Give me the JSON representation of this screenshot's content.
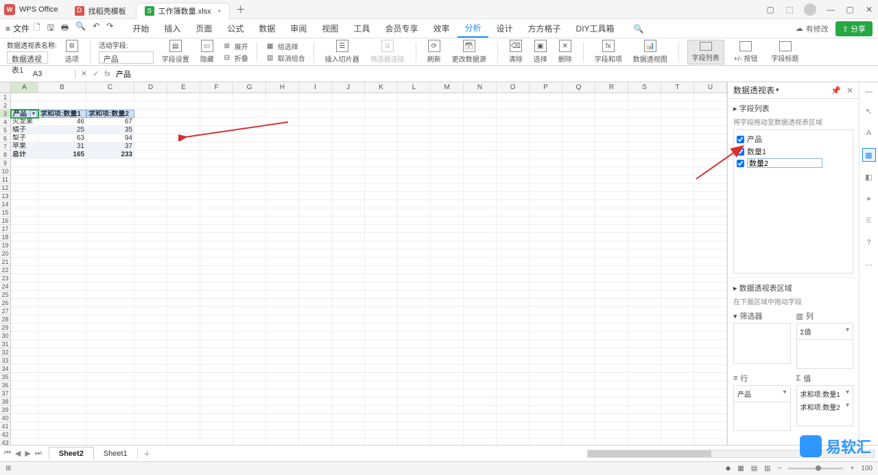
{
  "app": {
    "name": "WPS Office"
  },
  "tabs": [
    {
      "icon": "D",
      "iconColor": "#d9534f",
      "label": "找稻壳模板"
    },
    {
      "icon": "S",
      "iconColor": "#28a745",
      "label": "工作簿数量.xlsx",
      "active": true
    }
  ],
  "fileMenu": "文件",
  "menu": [
    "开始",
    "插入",
    "页面",
    "公式",
    "数据",
    "审阅",
    "视图",
    "工具",
    "会员专享",
    "效率",
    "分析",
    "设计",
    "方方格子",
    "DIY工具箱"
  ],
  "menuActive": "分析",
  "changes": "有修改",
  "share": "分享",
  "ribbon": {
    "pivotNameLbl": "数据透视表名称:",
    "pivotName": "数据透视表1",
    "options": "选项",
    "activeFieldLbl": "活动字段:",
    "activeField": "产品",
    "fieldSettings": "字段设置",
    "hide": "隐藏",
    "expand": "展开",
    "collapse": "折叠",
    "groupSel": "组选择",
    "ungroup": "取消组合",
    "slicer": "插入切片器",
    "filterConn": "筛选器连接",
    "refresh": "刷新",
    "changeSrc": "更改数据源",
    "clear": "清除",
    "select": "选择",
    "delete": "删除",
    "calcField": "字段和项",
    "pivotChart": "数据透视图",
    "fieldList": "字段列表",
    "btns": "+/- 按钮",
    "fieldTitle": "字段标题"
  },
  "nameBox": "A3",
  "formula": "产品",
  "columns": [
    "A",
    "B",
    "C",
    "D",
    "E",
    "F",
    "G",
    "H",
    "I",
    "J",
    "K",
    "L",
    "M",
    "N",
    "O",
    "P",
    "Q",
    "R",
    "S",
    "T",
    "U"
  ],
  "pivot": {
    "headers": [
      "产品",
      "求和项:数量1",
      "求和项:数量2"
    ],
    "rows": [
      {
        "label": "火龙果",
        "v1": "46",
        "v2": "67"
      },
      {
        "label": "橘子",
        "v1": "25",
        "v2": "35"
      },
      {
        "label": "梨子",
        "v1": "63",
        "v2": "94"
      },
      {
        "label": "苹果",
        "v1": "31",
        "v2": "37"
      }
    ],
    "totalLabel": "总计",
    "t1": "165",
    "t2": "233"
  },
  "panel": {
    "title": "数据透视表",
    "fieldList": "字段列表",
    "dragHint": "将字段拖动至数据透视表区域",
    "fields": [
      {
        "label": "产品",
        "checked": true
      },
      {
        "label": "数量1",
        "checked": true
      },
      {
        "label": "数量2",
        "checked": true,
        "editing": true
      }
    ],
    "areaTitle": "数据透视表区域",
    "areaHint": "在下面区域中拖动字段",
    "filterLbl": "筛选器",
    "colLbl": "列",
    "colItems": [
      "Σ值"
    ],
    "rowLbl": "行",
    "rowItems": [
      "产品"
    ],
    "valLbl": "值",
    "valItems": [
      "求和项:数量1",
      "求和项:数量2"
    ]
  },
  "sheets": {
    "active": "Sheet2",
    "other": "Sheet1"
  },
  "zoom": "100",
  "watermark": "易软汇"
}
